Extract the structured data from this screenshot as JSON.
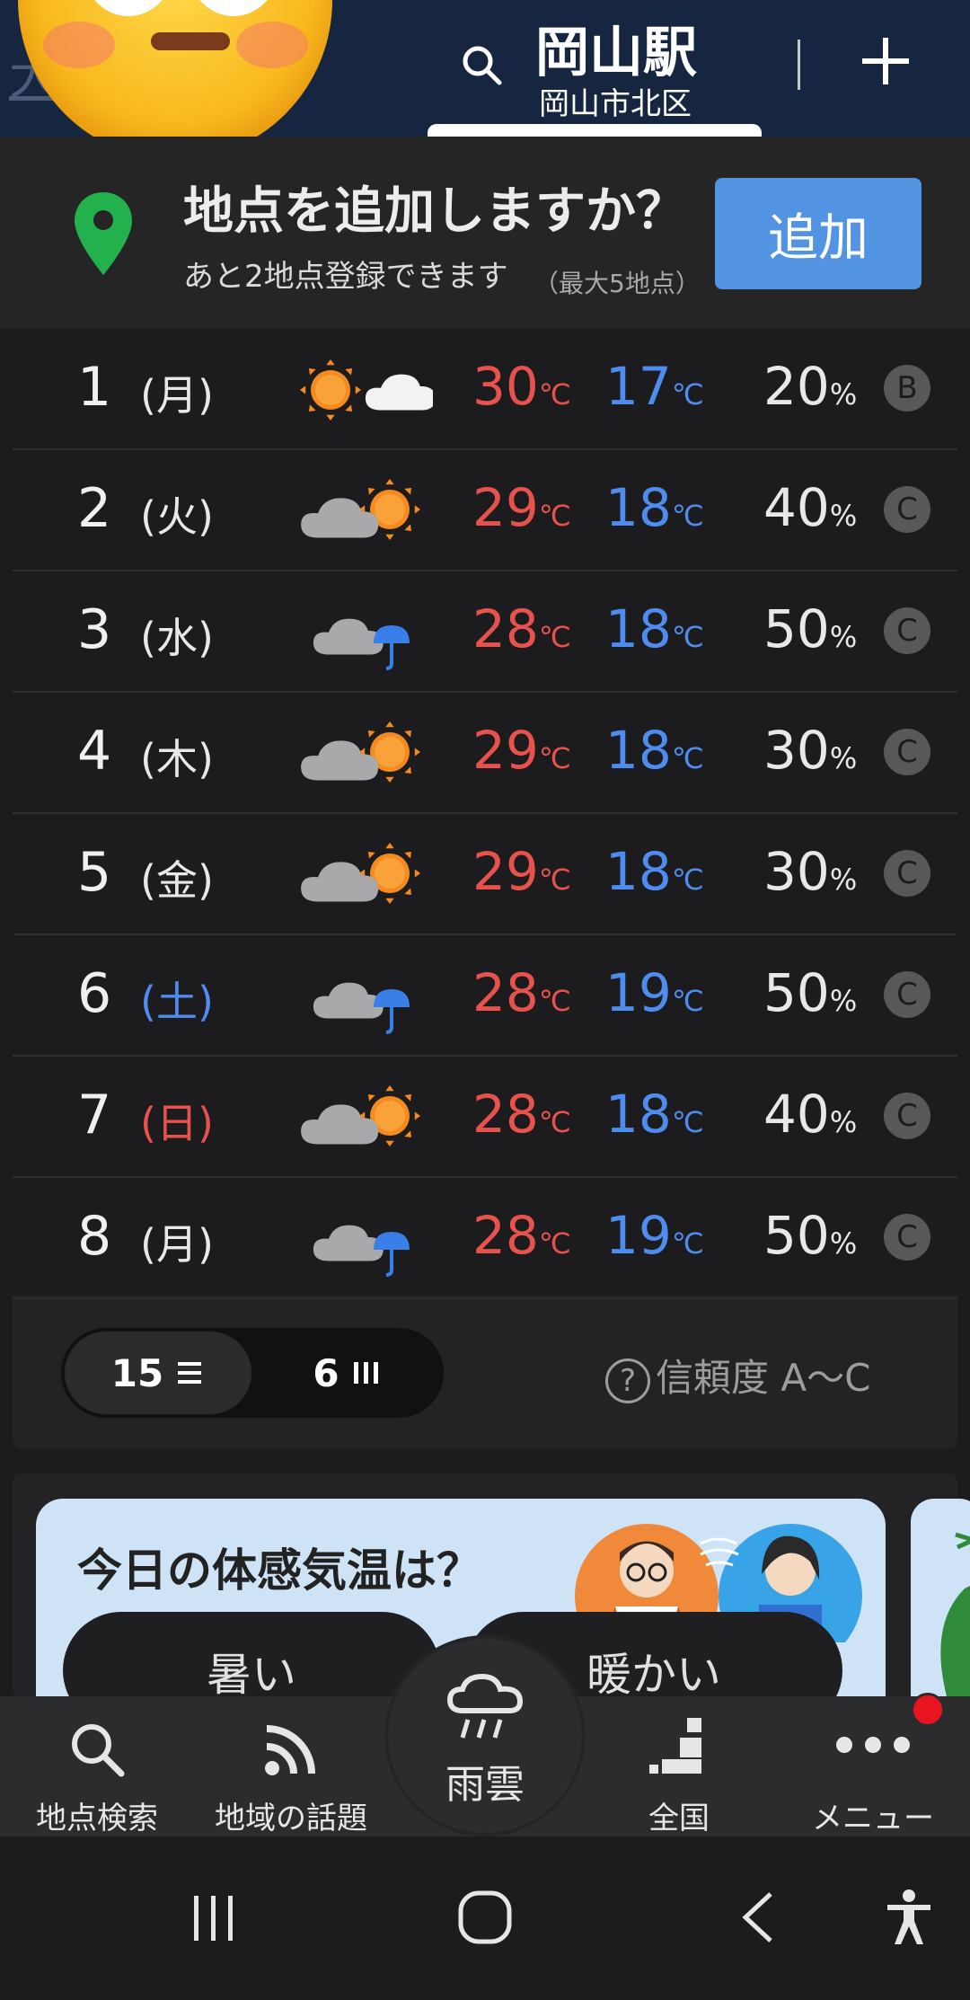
{
  "header": {
    "prev_location_partial": "大        区",
    "station": "岡山駅",
    "city": "岡山市北区"
  },
  "banner": {
    "title": "地点を追加しますか？",
    "subtitle": "あと2地点登録できます",
    "note": "（最大5地点）",
    "add_label": "追加"
  },
  "forecast": [
    {
      "day": "1",
      "dow": "(月)",
      "icon": "sun-cloud-icon",
      "hi": "30",
      "lo": "17",
      "pop": "20",
      "grade": "B",
      "dow_type": "weekday"
    },
    {
      "day": "2",
      "dow": "(火)",
      "icon": "cloud-sun-icon",
      "hi": "29",
      "lo": "18",
      "pop": "40",
      "grade": "C",
      "dow_type": "weekday"
    },
    {
      "day": "3",
      "dow": "(水)",
      "icon": "cloud-umbrella-icon",
      "hi": "28",
      "lo": "18",
      "pop": "50",
      "grade": "C",
      "dow_type": "weekday"
    },
    {
      "day": "4",
      "dow": "(木)",
      "icon": "cloud-sun-icon",
      "hi": "29",
      "lo": "18",
      "pop": "30",
      "grade": "C",
      "dow_type": "weekday"
    },
    {
      "day": "5",
      "dow": "(金)",
      "icon": "cloud-sun-icon",
      "hi": "29",
      "lo": "18",
      "pop": "30",
      "grade": "C",
      "dow_type": "weekday"
    },
    {
      "day": "6",
      "dow": "(土)",
      "icon": "cloud-umbrella-icon",
      "hi": "28",
      "lo": "19",
      "pop": "50",
      "grade": "C",
      "dow_type": "sat"
    },
    {
      "day": "7",
      "dow": "(日)",
      "icon": "cloud-sun-icon",
      "hi": "28",
      "lo": "18",
      "pop": "40",
      "grade": "C",
      "dow_type": "sun"
    },
    {
      "day": "8",
      "dow": "(月)",
      "icon": "cloud-umbrella-icon",
      "hi": "28",
      "lo": "19",
      "pop": "50",
      "grade": "C",
      "dow_type": "weekday"
    }
  ],
  "units": {
    "temp": "℃",
    "pop": "%"
  },
  "toggle": {
    "a_label": "15",
    "b_label": "6"
  },
  "reliability": {
    "q": "?",
    "label": "信頼度 A〜C"
  },
  "promo": {
    "title": "今日の体感気温は？",
    "option1": "暑い",
    "option2": "暖かい"
  },
  "bottom_nav": {
    "search": "地点検索",
    "topics": "地域の話題",
    "rain": "雨雲",
    "nation": "全国",
    "menu": "メニュー"
  },
  "colors": {
    "hi": "#e8524c",
    "lo": "#4f8cf0",
    "accent": "#5294e2",
    "header": "#172640",
    "badge": "#e8141f"
  }
}
